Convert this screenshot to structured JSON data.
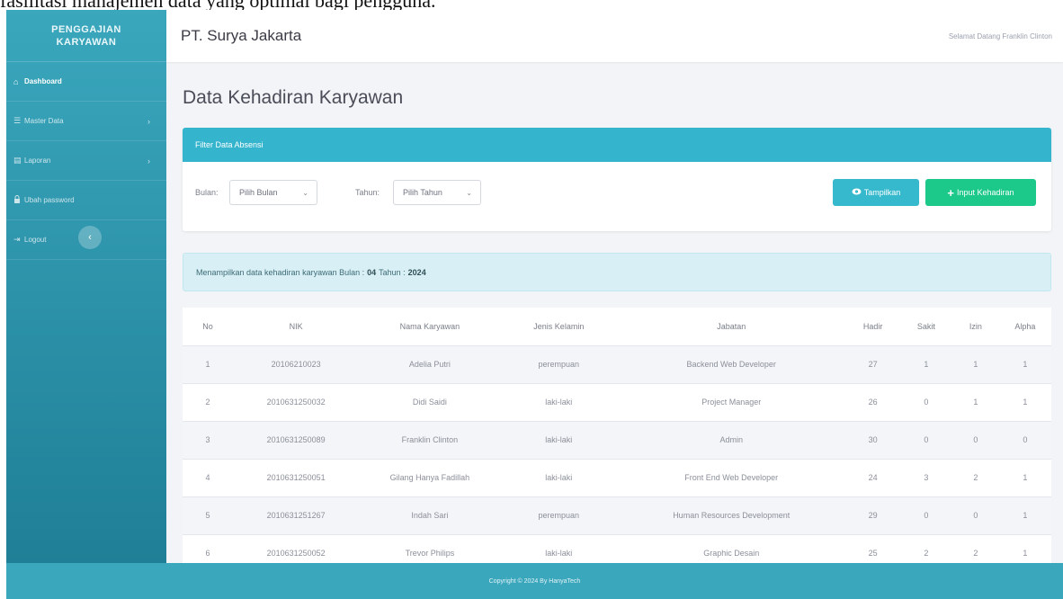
{
  "caption": "fasilitasi manajemen data yang optimal bagi pengguna.",
  "sidebar": {
    "brand_line1": "PENGGAJIAN",
    "brand_line2": "KARYAWAN",
    "items": [
      {
        "icon": "home-icon",
        "glyph": "⌂",
        "label": "Dashboard",
        "active": true,
        "has_chevron": false
      },
      {
        "icon": "database-icon",
        "glyph": "☰",
        "label": "Master Data",
        "active": false,
        "has_chevron": true
      },
      {
        "icon": "report-icon",
        "glyph": "▤",
        "label": "Laporan",
        "active": false,
        "has_chevron": true
      },
      {
        "icon": "lock-icon",
        "glyph": "🔒",
        "label": "Ubah password",
        "active": false,
        "has_chevron": false
      },
      {
        "icon": "logout-icon",
        "glyph": "⇥",
        "label": "Logout",
        "active": false,
        "has_chevron": false
      }
    ],
    "toggle_glyph": "‹"
  },
  "topbar": {
    "company": "PT. Surya Jakarta",
    "greeting": "Selamat Datang Franklin Clinton"
  },
  "page_title": "Data Kehadiran Karyawan",
  "filter": {
    "header": "Filter Data Absensi",
    "bulan_label": "Bulan:",
    "bulan_value": "Pilih Bulan",
    "tahun_label": "Tahun:",
    "tahun_value": "Pilih Tahun",
    "btn_show": "Tampilkan",
    "btn_input": "Input Kehadiran"
  },
  "info": {
    "prefix": "Menampilkan data kehadiran karyawan Bulan :",
    "bulan": "04",
    "tahun_label": "Tahun :",
    "tahun": "2024"
  },
  "table": {
    "headers": [
      "No",
      "NIK",
      "Nama Karyawan",
      "Jenis Kelamin",
      "Jabatan",
      "Hadir",
      "Sakit",
      "Izin",
      "Alpha"
    ],
    "rows": [
      [
        "1",
        "20106210023",
        "Adelia Putri",
        "perempuan",
        "Backend Web Developer",
        "27",
        "1",
        "1",
        "1"
      ],
      [
        "2",
        "2010631250032",
        "Didi Saidi",
        "laki-laki",
        "Project Manager",
        "26",
        "0",
        "1",
        "1"
      ],
      [
        "3",
        "2010631250089",
        "Franklin Clinton",
        "laki-laki",
        "Admin",
        "30",
        "0",
        "0",
        "0"
      ],
      [
        "4",
        "2010631250051",
        "Gilang Hanya Fadillah",
        "laki-laki",
        "Front End Web Developer",
        "24",
        "3",
        "2",
        "1"
      ],
      [
        "5",
        "2010631251267",
        "Indah Sari",
        "perempuan",
        "Human Resources Development",
        "29",
        "0",
        "0",
        "1"
      ],
      [
        "6",
        "2010631250052",
        "Trevor Philips",
        "laki-laki",
        "Graphic Desain",
        "25",
        "2",
        "2",
        "1"
      ]
    ]
  },
  "footer": "Copyright © 2024 By HanyaTech"
}
